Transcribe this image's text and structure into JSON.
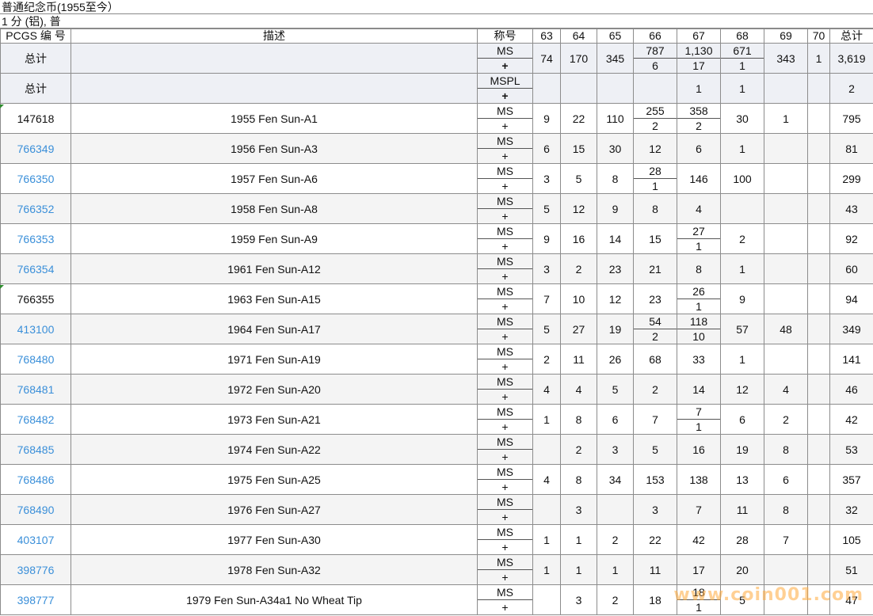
{
  "title": "普通纪念币(1955至今）",
  "subtitle": "1 分 (铝), 普",
  "headers": {
    "id": "PCGS 编 号",
    "desc": "描述",
    "designation": "称号",
    "grades": [
      "63",
      "64",
      "65",
      "66",
      "67",
      "68",
      "69",
      "70"
    ],
    "total": "总计"
  },
  "totals": [
    {
      "label": "总计",
      "des_top": "MS",
      "des_bot": "+",
      "cells": [
        {
          "v": "74"
        },
        {
          "v": "170"
        },
        {
          "v": "345"
        },
        {
          "top": "787",
          "bot": "6"
        },
        {
          "top": "1,130",
          "bot": "17"
        },
        {
          "top": "671",
          "bot": "1"
        },
        {
          "v": "343"
        },
        {
          "v": "1"
        }
      ],
      "total": "3,619"
    },
    {
      "label": "总计",
      "des_top": "MSPL",
      "des_bot": "+",
      "cells": [
        {
          "v": ""
        },
        {
          "v": ""
        },
        {
          "v": ""
        },
        {
          "v": ""
        },
        {
          "v": "1"
        },
        {
          "v": "1"
        },
        {
          "v": ""
        },
        {
          "v": ""
        }
      ],
      "total": "2"
    }
  ],
  "rows": [
    {
      "id": "147618",
      "link": false,
      "desc": "1955 Fen Sun-A1",
      "des_top": "MS",
      "des_bot": "+",
      "cells": [
        {
          "v": "9"
        },
        {
          "v": "22"
        },
        {
          "v": "110"
        },
        {
          "top": "255",
          "bot": "2"
        },
        {
          "top": "358",
          "bot": "2"
        },
        {
          "v": "30"
        },
        {
          "v": "1"
        },
        {
          "v": ""
        }
      ],
      "total": "795"
    },
    {
      "id": "766349",
      "link": true,
      "desc": "1956 Fen Sun-A3",
      "des_top": "MS",
      "des_bot": "+",
      "cells": [
        {
          "v": "6"
        },
        {
          "v": "15"
        },
        {
          "v": "30"
        },
        {
          "v": "12"
        },
        {
          "v": "6"
        },
        {
          "v": "1"
        },
        {
          "v": ""
        },
        {
          "v": ""
        }
      ],
      "total": "81"
    },
    {
      "id": "766350",
      "link": true,
      "desc": "1957 Fen Sun-A6",
      "des_top": "MS",
      "des_bot": "+",
      "cells": [
        {
          "v": "3"
        },
        {
          "v": "5"
        },
        {
          "v": "8"
        },
        {
          "top": "28",
          "bot": "1"
        },
        {
          "v": "146"
        },
        {
          "v": "100"
        },
        {
          "v": ""
        },
        {
          "v": ""
        }
      ],
      "total": "299"
    },
    {
      "id": "766352",
      "link": true,
      "desc": "1958 Fen Sun-A8",
      "des_top": "MS",
      "des_bot": "+",
      "cells": [
        {
          "v": "5"
        },
        {
          "v": "12"
        },
        {
          "v": "9"
        },
        {
          "v": "8"
        },
        {
          "v": "4"
        },
        {
          "v": ""
        },
        {
          "v": ""
        },
        {
          "v": ""
        }
      ],
      "total": "43"
    },
    {
      "id": "766353",
      "link": true,
      "desc": "1959 Fen Sun-A9",
      "des_top": "MS",
      "des_bot": "+",
      "cells": [
        {
          "v": "9"
        },
        {
          "v": "16"
        },
        {
          "v": "14"
        },
        {
          "v": "15"
        },
        {
          "top": "27",
          "bot": "1"
        },
        {
          "v": "2"
        },
        {
          "v": ""
        },
        {
          "v": ""
        }
      ],
      "total": "92"
    },
    {
      "id": "766354",
      "link": true,
      "desc": "1961 Fen Sun-A12",
      "des_top": "MS",
      "des_bot": "+",
      "cells": [
        {
          "v": "3"
        },
        {
          "v": "2"
        },
        {
          "v": "23"
        },
        {
          "v": "21"
        },
        {
          "v": "8"
        },
        {
          "v": "1"
        },
        {
          "v": ""
        },
        {
          "v": ""
        }
      ],
      "total": "60"
    },
    {
      "id": "766355",
      "link": false,
      "desc": "1963 Fen Sun-A15",
      "des_top": "MS",
      "des_bot": "+",
      "cells": [
        {
          "v": "7"
        },
        {
          "v": "10"
        },
        {
          "v": "12"
        },
        {
          "v": "23"
        },
        {
          "top": "26",
          "bot": "1"
        },
        {
          "v": "9"
        },
        {
          "v": ""
        },
        {
          "v": ""
        }
      ],
      "total": "94"
    },
    {
      "id": "413100",
      "link": true,
      "desc": "1964 Fen Sun-A17",
      "des_top": "MS",
      "des_bot": "+",
      "cells": [
        {
          "v": "5"
        },
        {
          "v": "27"
        },
        {
          "v": "19"
        },
        {
          "top": "54",
          "bot": "2"
        },
        {
          "top": "118",
          "bot": "10"
        },
        {
          "v": "57"
        },
        {
          "v": "48"
        },
        {
          "v": ""
        }
      ],
      "total": "349"
    },
    {
      "id": "768480",
      "link": true,
      "desc": "1971 Fen Sun-A19",
      "des_top": "MS",
      "des_bot": "+",
      "cells": [
        {
          "v": "2"
        },
        {
          "v": "11"
        },
        {
          "v": "26"
        },
        {
          "v": "68"
        },
        {
          "v": "33"
        },
        {
          "v": "1"
        },
        {
          "v": ""
        },
        {
          "v": ""
        }
      ],
      "total": "141"
    },
    {
      "id": "768481",
      "link": true,
      "desc": "1972 Fen Sun-A20",
      "des_top": "MS",
      "des_bot": "+",
      "cells": [
        {
          "v": "4"
        },
        {
          "v": "4"
        },
        {
          "v": "5"
        },
        {
          "v": "2"
        },
        {
          "v": "14"
        },
        {
          "v": "12"
        },
        {
          "v": "4"
        },
        {
          "v": ""
        }
      ],
      "total": "46"
    },
    {
      "id": "768482",
      "link": true,
      "desc": "1973 Fen Sun-A21",
      "des_top": "MS",
      "des_bot": "+",
      "cells": [
        {
          "v": "1"
        },
        {
          "v": "8"
        },
        {
          "v": "6"
        },
        {
          "v": "7"
        },
        {
          "top": "7",
          "bot": "1"
        },
        {
          "v": "6"
        },
        {
          "v": "2"
        },
        {
          "v": ""
        }
      ],
      "total": "42"
    },
    {
      "id": "768485",
      "link": true,
      "desc": "1974 Fen Sun-A22",
      "des_top": "MS",
      "des_bot": "+",
      "cells": [
        {
          "v": ""
        },
        {
          "v": "2"
        },
        {
          "v": "3"
        },
        {
          "v": "5"
        },
        {
          "v": "16"
        },
        {
          "v": "19"
        },
        {
          "v": "8"
        },
        {
          "v": ""
        }
      ],
      "total": "53"
    },
    {
      "id": "768486",
      "link": true,
      "desc": "1975 Fen Sun-A25",
      "des_top": "MS",
      "des_bot": "+",
      "cells": [
        {
          "v": "4"
        },
        {
          "v": "8"
        },
        {
          "v": "34"
        },
        {
          "v": "153"
        },
        {
          "v": "138"
        },
        {
          "v": "13"
        },
        {
          "v": "6"
        },
        {
          "v": ""
        }
      ],
      "total": "357"
    },
    {
      "id": "768490",
      "link": true,
      "desc": "1976 Fen Sun-A27",
      "des_top": "MS",
      "des_bot": "+",
      "cells": [
        {
          "v": ""
        },
        {
          "v": "3"
        },
        {
          "v": ""
        },
        {
          "v": "3"
        },
        {
          "v": "7"
        },
        {
          "v": "11"
        },
        {
          "v": "8"
        },
        {
          "v": ""
        }
      ],
      "total": "32"
    },
    {
      "id": "403107",
      "link": true,
      "desc": "1977 Fen Sun-A30",
      "des_top": "MS",
      "des_bot": "+",
      "cells": [
        {
          "v": "1"
        },
        {
          "v": "1"
        },
        {
          "v": "2"
        },
        {
          "v": "22"
        },
        {
          "v": "42"
        },
        {
          "v": "28"
        },
        {
          "v": "7"
        },
        {
          "v": ""
        }
      ],
      "total": "105"
    },
    {
      "id": "398776",
      "link": true,
      "desc": "1978 Fen Sun-A32",
      "des_top": "MS",
      "des_bot": "+",
      "cells": [
        {
          "v": "1"
        },
        {
          "v": "1"
        },
        {
          "v": "1"
        },
        {
          "v": "11"
        },
        {
          "v": "17"
        },
        {
          "v": "20"
        },
        {
          "v": ""
        },
        {
          "v": ""
        }
      ],
      "total": "51"
    },
    {
      "id": "398777",
      "link": true,
      "desc": "1979 Fen Sun-A34a1 No Wheat Tip",
      "des_top": "MS",
      "des_bot": "+",
      "cells": [
        {
          "v": ""
        },
        {
          "v": "3"
        },
        {
          "v": "2"
        },
        {
          "v": "18"
        },
        {
          "top": "18",
          "bot": "1"
        },
        {
          "v": "5"
        },
        {
          "v": ""
        },
        {
          "v": ""
        }
      ],
      "total": "47"
    }
  ],
  "watermark": "www.coin001.com"
}
